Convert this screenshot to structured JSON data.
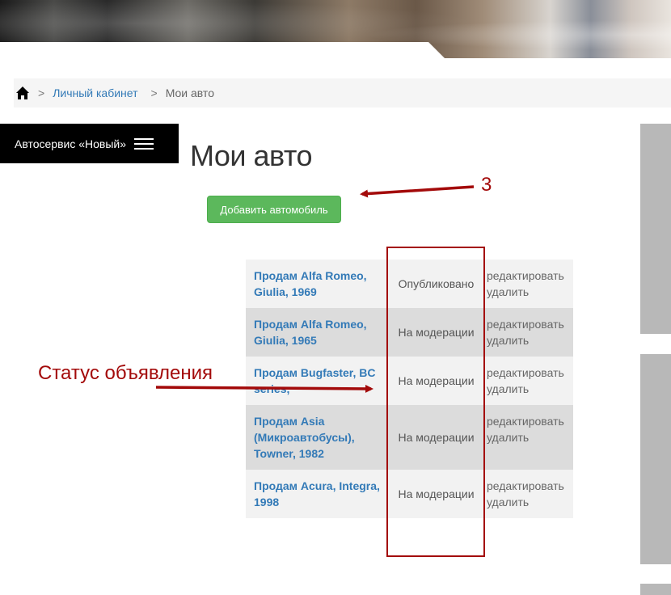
{
  "breadcrumb": {
    "home_icon": "home-icon",
    "separator": ">",
    "link": "Личный кабинет",
    "current": "Мои авто"
  },
  "side_menu": {
    "label": "Автосервис «Новый»",
    "icon": "hamburger-icon"
  },
  "page": {
    "title": "Мои авто",
    "add_button": "Добавить автомобиль"
  },
  "ads": [
    {
      "title": "Продам Alfa Romeo, Giulia, 1969",
      "status": "Опубликовано",
      "edit": "редактировать",
      "delete": "удалить"
    },
    {
      "title": "Продам Alfa Romeo, Giulia, 1965",
      "status": "На модерации",
      "edit": "редактировать",
      "delete": "удалить"
    },
    {
      "title": "Продам Bugfaster, BC series,",
      "status": "На модерации",
      "edit": "редактировать",
      "delete": "удалить"
    },
    {
      "title": "Продам Asia (Микроавтобусы), Towner, 1982",
      "status": "На модерации",
      "edit": "редактировать",
      "delete": "удалить"
    },
    {
      "title": "Продам Acura, Integra, 1998",
      "status": "На модерации",
      "edit": "редактировать",
      "delete": "удалить"
    }
  ],
  "annotations": {
    "number": "3",
    "status_label": "Статус объявления",
    "color": "#a30a0a"
  },
  "colors": {
    "button_green": "#5cb85c",
    "link_blue": "#337ab7"
  }
}
